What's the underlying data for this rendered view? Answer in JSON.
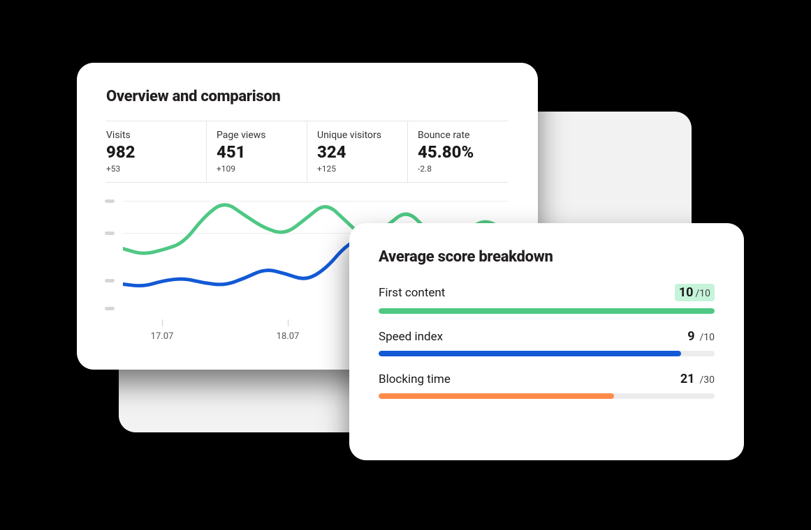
{
  "overview": {
    "title": "Overview and comparison",
    "stats": [
      {
        "label": "Visits",
        "value": "982",
        "delta": "+53"
      },
      {
        "label": "Page views",
        "value": "451",
        "delta": "+109"
      },
      {
        "label": "Unique visitors",
        "value": "324",
        "delta": "+125"
      },
      {
        "label": "Bounce rate",
        "value": "45.80%",
        "delta": "-2.8"
      }
    ],
    "x_labels": [
      "17.07",
      "18.07"
    ]
  },
  "chart_data": {
    "type": "line",
    "xlabel": "",
    "ylabel": "",
    "x_ticks": [
      "17.07",
      "18.07"
    ],
    "series": [
      {
        "name": "series-a",
        "color": "#4fc884",
        "values": [
          55,
          50,
          54,
          60,
          82,
          95,
          83,
          72,
          67,
          80,
          94,
          78,
          62,
          74,
          88,
          70,
          60,
          72,
          80,
          66
        ]
      },
      {
        "name": "series-b",
        "color": "#1259d6",
        "values": [
          25,
          23,
          28,
          30,
          26,
          24,
          30,
          38,
          34,
          28,
          38,
          58,
          66,
          55,
          50,
          62,
          70,
          62,
          56,
          66
        ]
      }
    ],
    "ylim": [
      0,
      100
    ]
  },
  "scores": {
    "title": "Average score breakdown",
    "rows": [
      {
        "label": "First content",
        "value": "10",
        "max": "/10",
        "fill_pct": 100,
        "color": "#4fc884",
        "badge": true
      },
      {
        "label": "Speed index",
        "value": "9",
        "max": "/10",
        "fill_pct": 90,
        "color": "#1259d6",
        "badge": false
      },
      {
        "label": "Blocking time",
        "value": "21",
        "max": "/30",
        "fill_pct": 70,
        "color": "#fe8b4a",
        "badge": false
      }
    ]
  },
  "colors": {
    "green": "#4fc884",
    "blue": "#1259d6",
    "orange": "#fe8b4a",
    "green_badge_bg": "#c6f4da"
  }
}
